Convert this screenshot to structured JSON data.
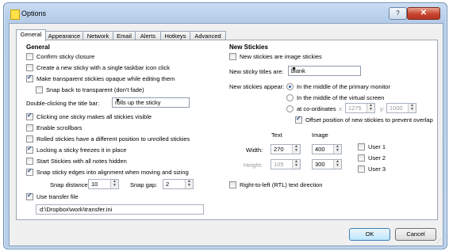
{
  "window": {
    "title": "Options",
    "help_glyph": "?",
    "close_glyph": "✕"
  },
  "tabs": [
    "General",
    "Appearance",
    "Network",
    "Email",
    "Alerts",
    "Hotkeys",
    "Advanced"
  ],
  "general": {
    "heading": "General",
    "confirm_closure": {
      "label": "Confirm sticky closure",
      "checked": false
    },
    "create_new_single_click": {
      "label": "Create a new sticky with a single taskbar icon click",
      "checked": false
    },
    "opaque_while_editing": {
      "label": "Make transparent stickies opaque while editing them",
      "checked": true
    },
    "snap_back_transparent": {
      "label": "Snap back to transparent (don't fade)",
      "checked": false
    },
    "double_click_label": "Double-clicking the title bar:",
    "double_click_value": "rolls up the sticky",
    "clicking_visible": {
      "label": "Clicking one sticky makes all stickies visible",
      "checked": true
    },
    "enable_scrollbars": {
      "label": "Enable scrollbars",
      "checked": false
    },
    "rolled_position": {
      "label": "Rolled stickies have a different position to unrolled stickies",
      "checked": false
    },
    "locking_freezes": {
      "label": "Locking a sticky freezes it in place",
      "checked": true
    },
    "start_hidden": {
      "label": "Start Stickies with all notes hidden",
      "checked": false
    },
    "snap_edges": {
      "label": "Snap sticky edges into alignment when moving and sizing",
      "checked": true
    },
    "snap_distance_label": "Snap distance:",
    "snap_distance_value": "10",
    "snap_gap_label": "Snap gap:",
    "snap_gap_value": "2",
    "use_transfer_file": {
      "label": "Use transfer file",
      "checked": true
    },
    "transfer_path": "d:\\Dropbox\\work\\transfer.ini"
  },
  "new_stickies": {
    "heading": "New Stickies",
    "image_stickies": {
      "label": "New stickies are image stickies",
      "checked": false
    },
    "titles_label": "New sticky titles are:",
    "titles_value": "blank",
    "appear_label": "New stickies appear:",
    "appear_options": [
      {
        "label": "In the middle of the primary monitor",
        "selected": true
      },
      {
        "label": "In the middle of the virtual screen",
        "selected": false
      },
      {
        "label": "at co-ordinates",
        "selected": false
      }
    ],
    "x_label": "x:",
    "x_value": "1275",
    "y_label": "y:",
    "y_value": "1000",
    "offset_position": {
      "label": "Offset position of new stickies to prevent overlap",
      "checked": true
    },
    "text_heading": "Text",
    "image_heading": "Image",
    "width_label": "Width:",
    "width_text": "270",
    "width_image": "400",
    "height_label": "Height:",
    "height_text": "105",
    "height_image": "300",
    "user1": {
      "label": "User 1",
      "checked": false
    },
    "user2": {
      "label": "User 2",
      "checked": false
    },
    "user3": {
      "label": "User 3",
      "checked": false
    },
    "rtl_direction": {
      "label": "Right-to-left (RTL) text direction",
      "checked": false
    }
  },
  "footer": {
    "ok": "OK",
    "cancel": "Cancel"
  }
}
